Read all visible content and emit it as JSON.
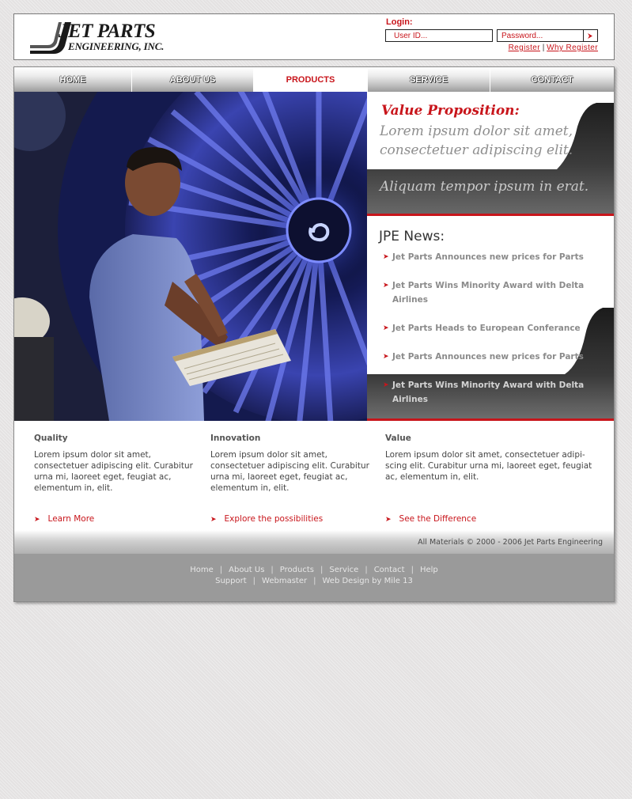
{
  "logo": {
    "line1": "JET PARTS",
    "line2": "ENGINEERING, INC."
  },
  "login": {
    "label": "Login:",
    "user_placeholder": "User ID...",
    "password_placeholder": "Password...",
    "register": "Register",
    "separator": "|",
    "why_register": "Why Register"
  },
  "nav": {
    "items": [
      "HOME",
      "ABOUT US",
      "PRODUCTS",
      "SERVICE",
      "CONTACT"
    ],
    "active": "PRODUCTS"
  },
  "value_prop": {
    "title": "Value Proposition:",
    "body": "Lorem ipsum dolor sit amet, consectetuer adipiscing elit.",
    "footer": "Aliquam tempor ipsum in erat."
  },
  "news": {
    "title": "JPE News:",
    "items": [
      "Jet Parts Announces new prices for Parts",
      "Jet Parts Wins Minority Award with Delta Airlines",
      "Jet Parts Heads to European Conferance",
      "Jet Parts Announces new prices for Parts",
      "Jet Parts Wins Minority Award with Delta Airlines"
    ]
  },
  "columns": [
    {
      "title": "Quality",
      "text": "Lorem ipsum dolor sit amet, consectetuer adipiscing elit. Curabitur urna mi, laoreet eget, feugiat ac, elementum in, elit.",
      "link": "Learn More"
    },
    {
      "title": "Innovation",
      "text": "Lorem ipsum dolor sit amet, consectetuer adipiscing elit. Curabitur urna mi, laoreet eget, feugiat ac, elementum in, elit.",
      "link": "Explore the possibilities"
    },
    {
      "title": "Value",
      "text": "Lorem ipsum dolor sit amet, consectetuer adipi-scing elit. Curabitur urna mi, laoreet eget, feugiat ac, elementum in, elit.",
      "link": "See the Difference"
    }
  ],
  "copyright": "All Materials © 2000 - 2006 Jet Parts Engineering",
  "footer": {
    "line1": [
      "Home",
      "About Us",
      "Products",
      "Service",
      "Contact",
      "Help"
    ],
    "line2": [
      "Support",
      "Webmaster",
      "Web Design by Mile 13"
    ],
    "separator": "|"
  },
  "colors": {
    "accent": "#c8151b",
    "background": "#e4e2e2",
    "footer_bg": "#9a9a9a"
  }
}
